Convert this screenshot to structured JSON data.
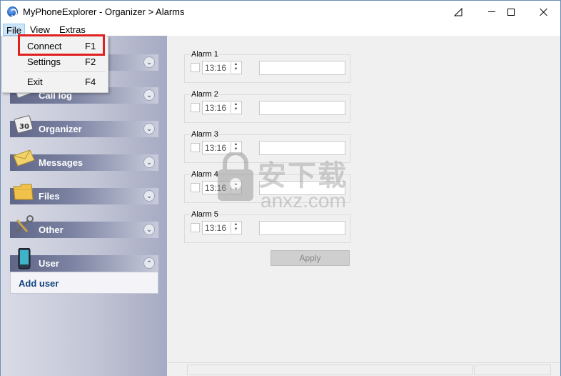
{
  "window": {
    "title": "MyPhoneExplorer -  Organizer > Alarms",
    "pin_glyph": "⊿"
  },
  "menubar": {
    "items": [
      {
        "label": "File"
      },
      {
        "label": "View"
      },
      {
        "label": "Extras"
      }
    ]
  },
  "file_menu": {
    "items": [
      {
        "label": "Connect",
        "shortcut": "F1"
      },
      {
        "label": "Settings",
        "shortcut": "F2"
      },
      {
        "label": "Exit",
        "shortcut": "F4"
      }
    ]
  },
  "sidebar": {
    "groups": [
      {
        "label": "",
        "icon": "phone-icon",
        "chevron": "⌄"
      },
      {
        "label": "Call log",
        "icon": "call-log-icon",
        "chevron": "⌄"
      },
      {
        "label": "Organizer",
        "icon": "calendar-icon",
        "chevron": "⌄"
      },
      {
        "label": "Messages",
        "icon": "envelope-icon",
        "chevron": "⌄"
      },
      {
        "label": "Files",
        "icon": "folder-icon",
        "chevron": "⌄"
      },
      {
        "label": "Other",
        "icon": "tools-icon",
        "chevron": "⌄"
      },
      {
        "label": "User",
        "icon": "phone-device-icon",
        "chevron": "⌃"
      }
    ],
    "user_action": "Add user"
  },
  "alarms": [
    {
      "title": "Alarm 1",
      "time": "13:16",
      "name": ""
    },
    {
      "title": "Alarm 2",
      "time": "13:16",
      "name": ""
    },
    {
      "title": "Alarm 3",
      "time": "13:16",
      "name": ""
    },
    {
      "title": "Alarm 4",
      "time": "13:16",
      "name": ""
    },
    {
      "title": "Alarm 5",
      "time": "13:16",
      "name": ""
    }
  ],
  "apply_label": "Apply",
  "watermark": {
    "text_cn": "安下载",
    "text_en": "anxz.com"
  },
  "colors": {
    "highlight": "#e02020",
    "sidebar_header": "#6b7292",
    "link": "#12427e"
  }
}
